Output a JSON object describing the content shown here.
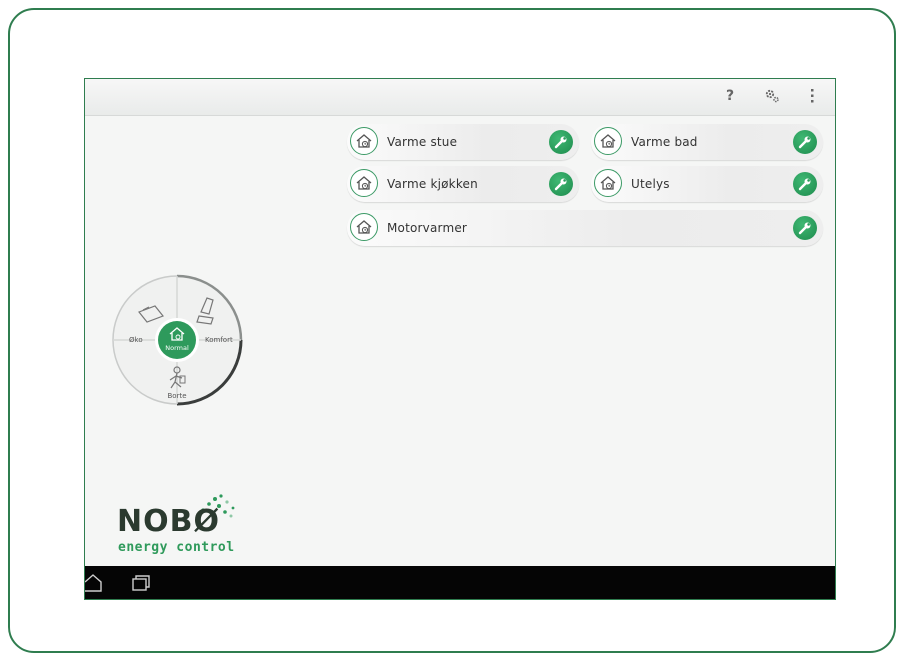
{
  "action_bar": {
    "help_icon": "?",
    "settings_icon": "gear-icon",
    "overflow_icon": "more-vertical-icon"
  },
  "zones": [
    {
      "label": "Varme stue"
    },
    {
      "label": "Varme bad"
    },
    {
      "label": "Varme kjøkken"
    },
    {
      "label": "Utelys"
    },
    {
      "label": "Motorvarmer"
    }
  ],
  "mode_dial": {
    "eco": "Øko",
    "comfort": "Komfort",
    "normal": "Normal",
    "away": "Borte",
    "selected": "Normal"
  },
  "logo": {
    "name": "NOBØ",
    "tagline": "energy control"
  },
  "nav_bar": {
    "home_icon": "home-icon",
    "recent_apps_icon": "recent-apps-icon"
  },
  "colors": {
    "brand_green": "#2e9a5c",
    "frame_green": "#2f7d4f",
    "nav_black": "#050505"
  }
}
